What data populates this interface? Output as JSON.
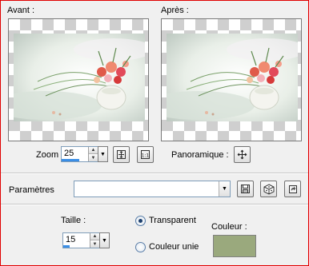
{
  "labels": {
    "before": "Avant :",
    "after": "Après :",
    "zoom": "Zoom :",
    "pan": "Panoramique :",
    "params": "Paramètres",
    "size": "Taille :",
    "transparent": "Transparent",
    "solid_color": "Couleur unie",
    "color": "Couleur :"
  },
  "zoom": {
    "value": "25"
  },
  "size": {
    "value": "15"
  },
  "params": {
    "value": ""
  },
  "options": {
    "selected": "transparent"
  },
  "colors": {
    "swatch": "#9aa97d",
    "frame_border": "#e00000",
    "accent": "#3a8ee6"
  },
  "icons": {
    "zoom_fit": "fit-window-icon",
    "zoom_actual": "actual-size-icon",
    "pan": "move-icon",
    "save_preset": "floppy-disk-icon",
    "random": "dice-icon",
    "reset": "reset-icon"
  }
}
